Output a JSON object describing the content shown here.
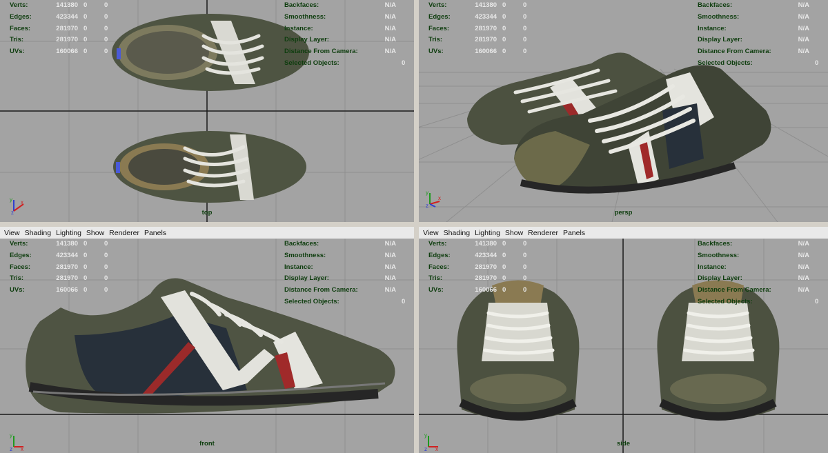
{
  "menu": [
    "View",
    "Shading",
    "Lighting",
    "Show",
    "Renderer",
    "Panels"
  ],
  "hud_left": [
    {
      "label": "Verts:",
      "v1": "141380",
      "v2": "0",
      "v3": "0"
    },
    {
      "label": "Edges:",
      "v1": "423344",
      "v2": "0",
      "v3": "0"
    },
    {
      "label": "Faces:",
      "v1": "281970",
      "v2": "0",
      "v3": "0"
    },
    {
      "label": "Tris:",
      "v1": "281970",
      "v2": "0",
      "v3": "0"
    },
    {
      "label": "UVs:",
      "v1": "160066",
      "v2": "0",
      "v3": "0"
    }
  ],
  "hud_right": [
    {
      "label": "Backfaces:",
      "v1": "N/A",
      "v2": ""
    },
    {
      "label": "Smoothness:",
      "v1": "N/A",
      "v2": ""
    },
    {
      "label": "Instance:",
      "v1": "N/A",
      "v2": ""
    },
    {
      "label": "Display Layer:",
      "v1": "N/A",
      "v2": ""
    },
    {
      "label": "Distance From Camera:",
      "v1": "N/A",
      "v2": ""
    },
    {
      "label": "Selected Objects:",
      "v1": "",
      "v2": "0"
    }
  ],
  "axes": {
    "x": "x",
    "y": "y",
    "z": "z"
  },
  "viewports": {
    "top": {
      "camera": "top"
    },
    "persp": {
      "camera": "persp"
    },
    "front": {
      "camera": "front"
    },
    "side": {
      "camera": "side"
    }
  },
  "colors": {
    "viewport_bg": "#a3a3a3",
    "grid": "#8f8f8f",
    "grid_axis": "#1a1a1a",
    "hud_label": "#0e3d0e",
    "hud_value": "#e8e8e8"
  }
}
